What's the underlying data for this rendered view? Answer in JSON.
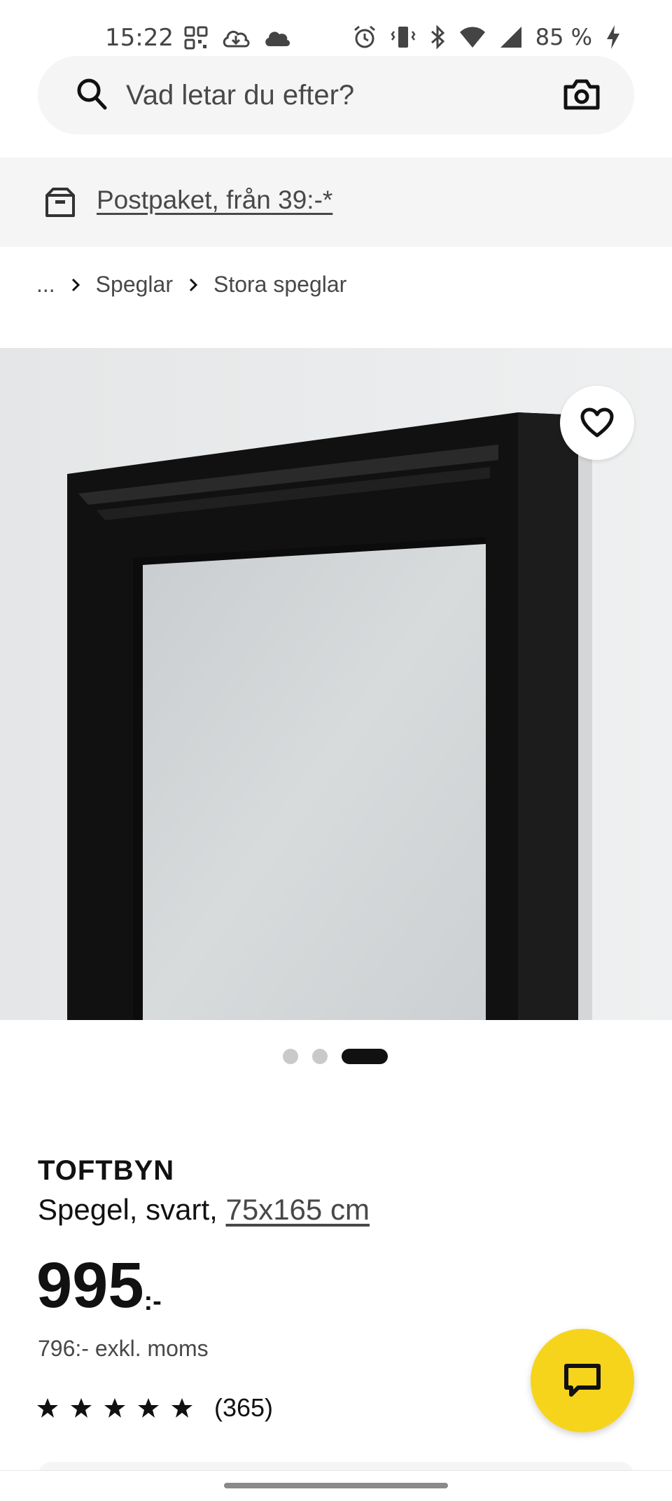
{
  "status_bar": {
    "time": "15:22",
    "battery": "85 %",
    "left_icons": [
      "qr-icon",
      "cloud-download-icon",
      "cloud-icon"
    ],
    "right_icons": [
      "alarm-icon",
      "vibrate-icon",
      "bluetooth-icon",
      "wifi-icon",
      "signal-icon",
      "battery-charging-icon"
    ]
  },
  "search": {
    "placeholder": "Vad letar du efter?"
  },
  "banner": {
    "link_text": "Postpaket, från 39:-*"
  },
  "breadcrumb": {
    "items": [
      "...",
      "Speglar",
      "Stora speglar"
    ]
  },
  "carousel": {
    "total": 3,
    "active_index": 2
  },
  "product": {
    "name": "TOFTBYN",
    "description": "Spegel, svart,",
    "size": "75x165 cm",
    "price": "995",
    "price_suffix": ":-",
    "price_ex_vat": "796:- exkl. moms",
    "rating_stars": 5,
    "rating_count": "(365)"
  },
  "colors": {
    "accent_yellow": "#f6d41c",
    "text_dark": "#111111",
    "text_grey": "#484848",
    "surface_grey": "#f5f5f5"
  }
}
